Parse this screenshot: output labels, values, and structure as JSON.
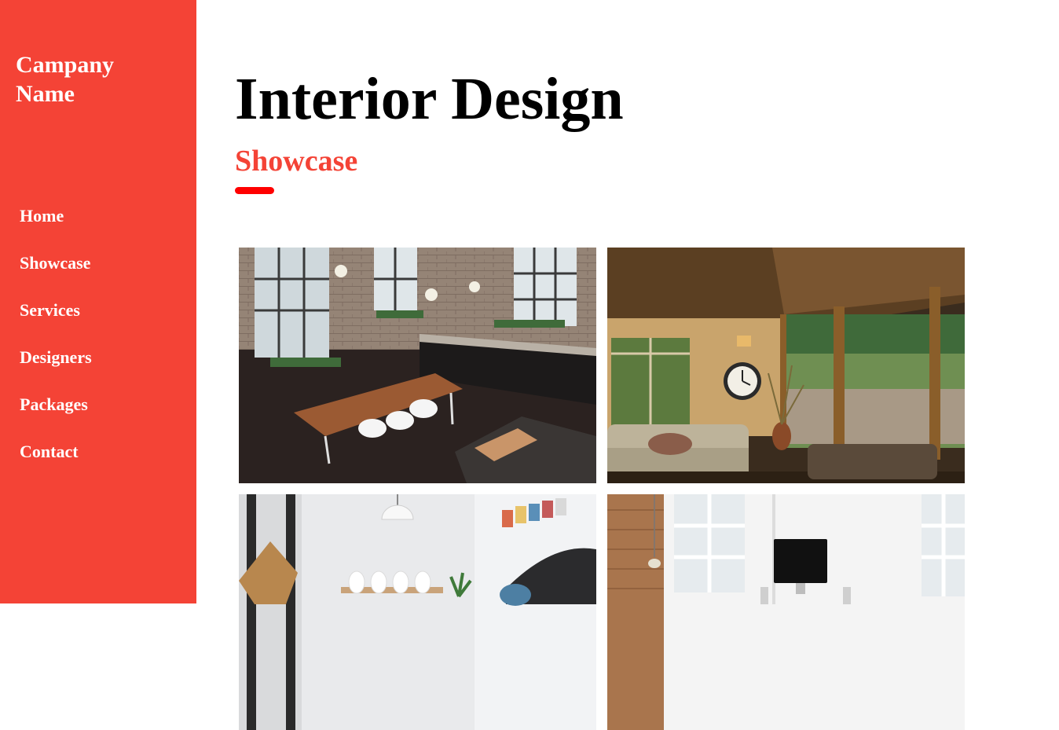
{
  "sidebar": {
    "brand": "Campany\nName",
    "items": [
      {
        "label": "Home"
      },
      {
        "label": "Showcase"
      },
      {
        "label": "Services"
      },
      {
        "label": "Designers"
      },
      {
        "label": "Packages"
      },
      {
        "label": "Contact"
      }
    ]
  },
  "header": {
    "title": "Interior Design",
    "subtitle": "Showcase"
  },
  "colors": {
    "sidebar_bg": "#f44336",
    "accent": "#f44336",
    "underline": "#ff0000",
    "title": "#000000"
  },
  "gallery": [
    {
      "icon": "loft-kitchen-photo"
    },
    {
      "icon": "living-room-porch-photo"
    },
    {
      "icon": "dining-room-photo"
    },
    {
      "icon": "workspace-photo"
    }
  ]
}
